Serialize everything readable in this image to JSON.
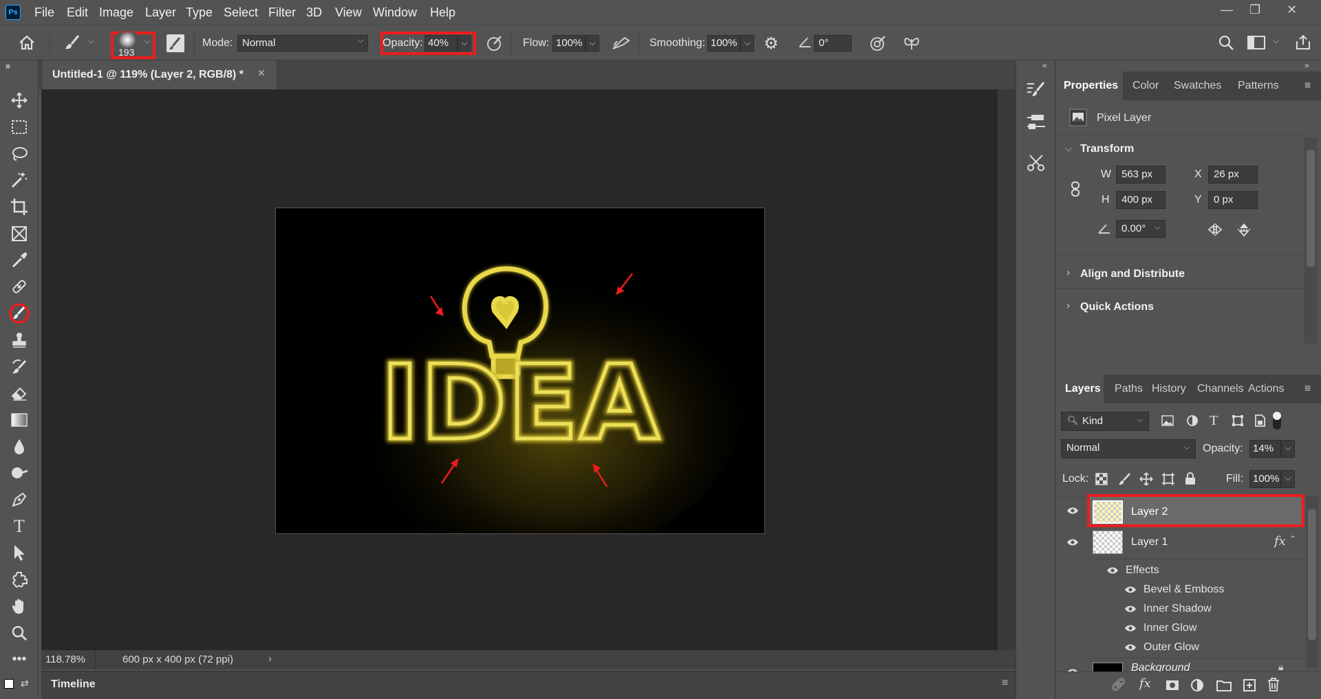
{
  "app": {
    "logo": "Ps"
  },
  "menu": [
    "File",
    "Edit",
    "Image",
    "Layer",
    "Type",
    "Select",
    "Filter",
    "3D",
    "View",
    "Window",
    "Help"
  ],
  "options": {
    "brush_size": "193",
    "mode_label": "Mode:",
    "mode_value": "Normal",
    "opacity_label": "Opacity:",
    "opacity_value": "40%",
    "flow_label": "Flow:",
    "flow_value": "100%",
    "smoothing_label": "Smoothing:",
    "smoothing_value": "100%",
    "angle_value": "0°"
  },
  "document": {
    "tab_title": "Untitled-1 @ 119% (Layer 2, RGB/8) *",
    "zoom": "118.78%",
    "doc_info": "600 px x 400 px (72 ppi)",
    "image_text": "IDEA"
  },
  "timeline_label": "Timeline",
  "properties": {
    "tabs": [
      "Properties",
      "Color",
      "Swatches",
      "Patterns"
    ],
    "type_label": "Pixel Layer",
    "transform_label": "Transform",
    "w_label": "W",
    "w_value": "563 px",
    "h_label": "H",
    "h_value": "400 px",
    "x_label": "X",
    "x_value": "26 px",
    "y_label": "Y",
    "y_value": "0 px",
    "angle_value": "0.00°",
    "align_label": "Align and Distribute",
    "quick_label": "Quick Actions"
  },
  "layers": {
    "tabs": [
      "Layers",
      "Paths",
      "History",
      "Channels",
      "Actions"
    ],
    "kind_label": "Kind",
    "blend_mode": "Normal",
    "opacity_label": "Opacity:",
    "opacity_value": "14%",
    "lock_label": "Lock:",
    "fill_label": "Fill:",
    "fill_value": "100%",
    "layer2": "Layer 2",
    "layer1": "Layer 1",
    "fx": "fx",
    "effects_label": "Effects",
    "effects": [
      "Bevel & Emboss",
      "Inner Shadow",
      "Inner Glow",
      "Outer Glow"
    ],
    "background": "Background"
  },
  "colors": {
    "highlight": "#ee1c1c",
    "glow": "#f5e84a"
  }
}
